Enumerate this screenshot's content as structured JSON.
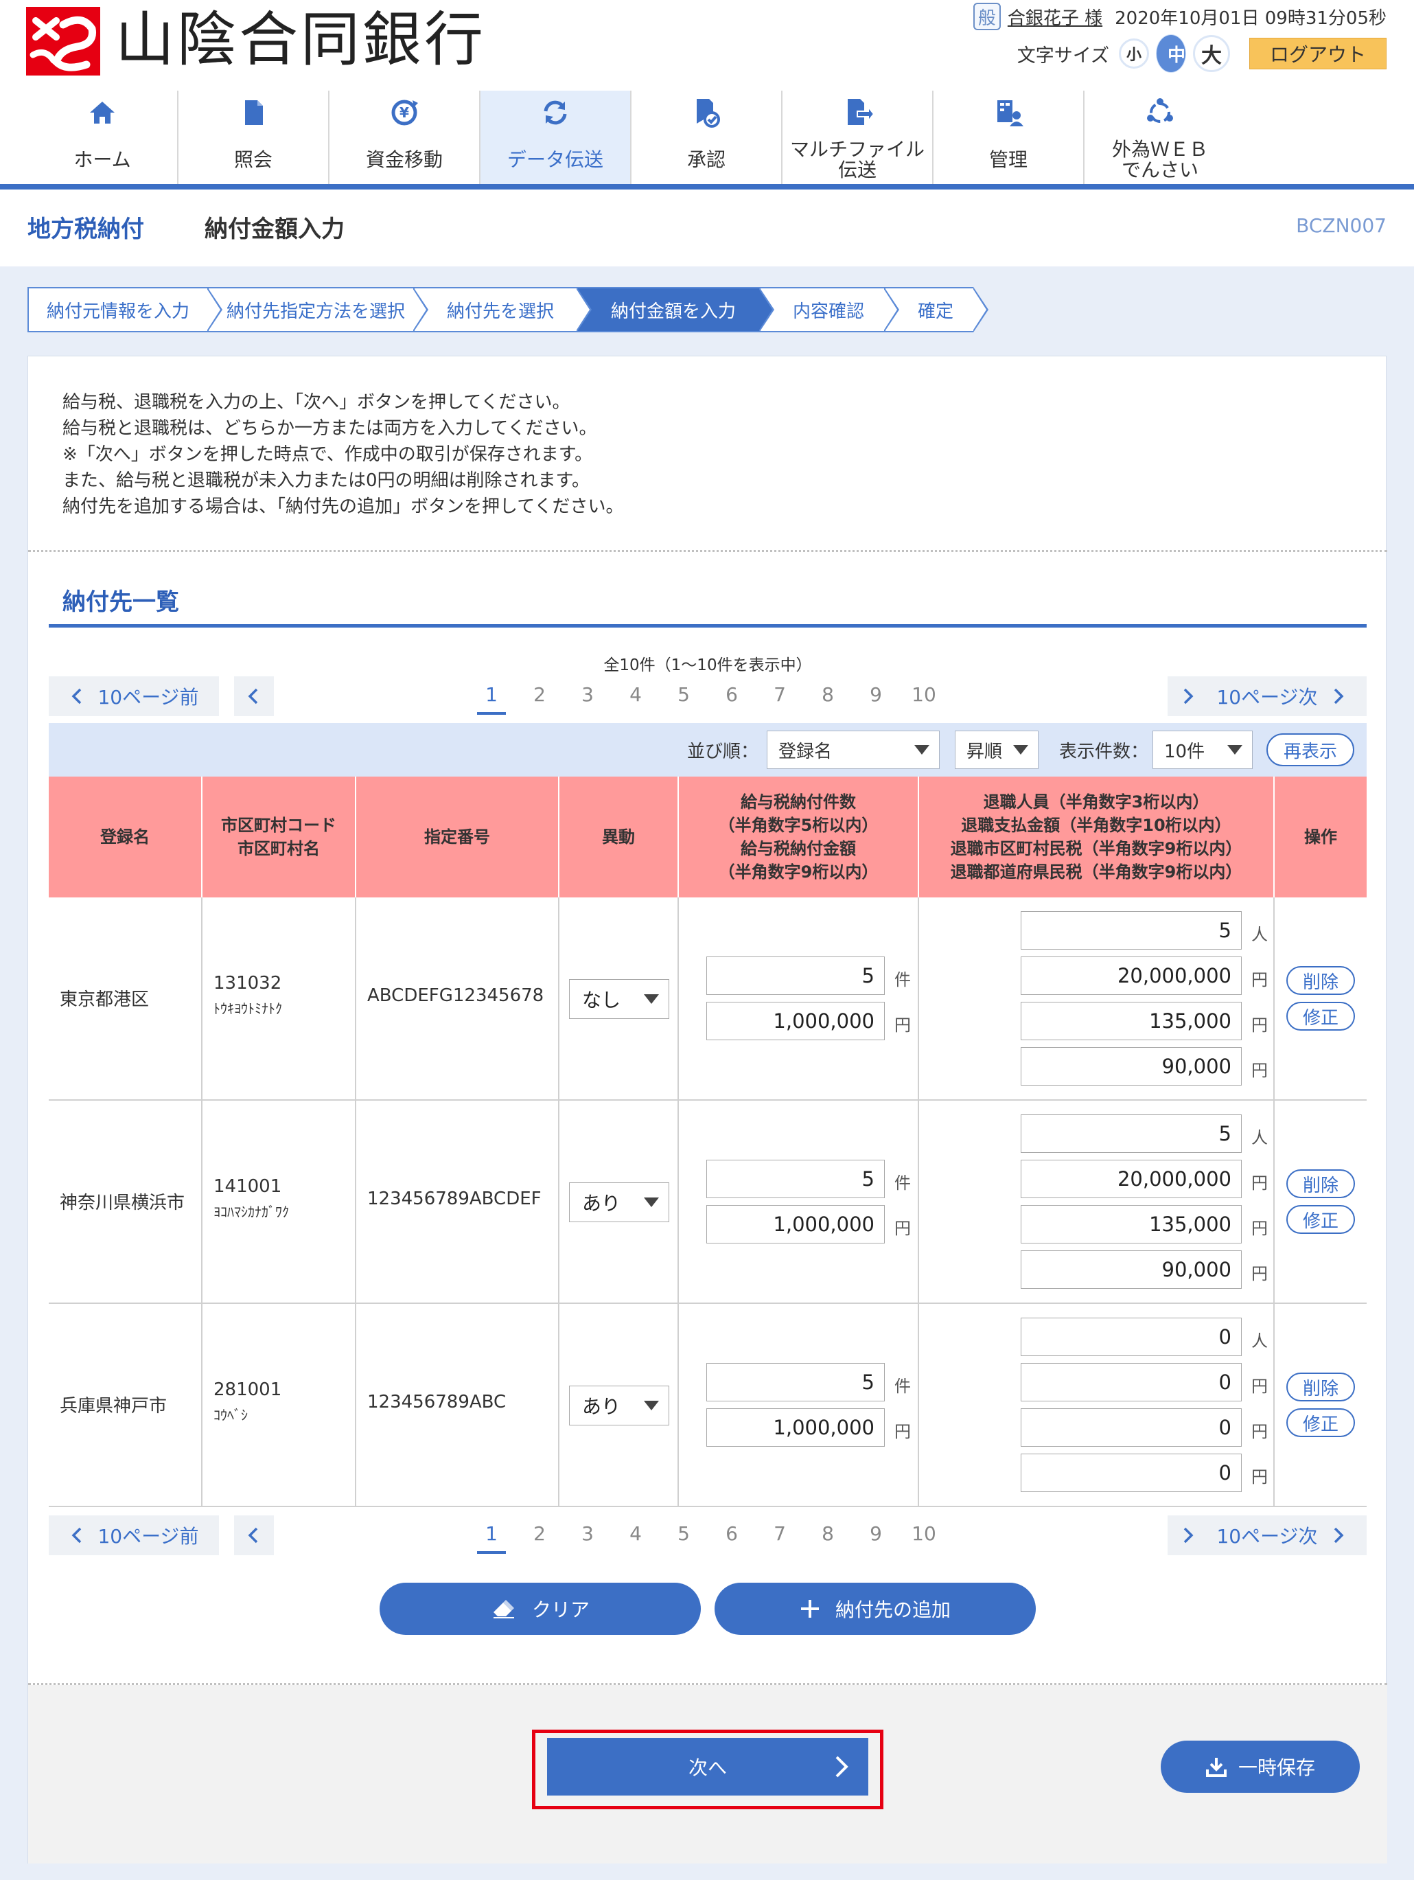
{
  "header": {
    "bank_name": "山陰合同銀行",
    "user_badge": "般",
    "user_name": "合銀花子 様",
    "datetime": "2020年10月01日 09時31分05秒",
    "font_size_label": "文字サイズ",
    "font_small": "小",
    "font_medium": "中",
    "font_large": "大",
    "logout": "ログアウト"
  },
  "nav": [
    {
      "label": "ホーム",
      "icon": "home-icon"
    },
    {
      "label": "照会",
      "icon": "document-icon"
    },
    {
      "label": "資金移動",
      "icon": "yen-transfer-icon"
    },
    {
      "label": "データ伝送",
      "icon": "refresh-icon",
      "active": true
    },
    {
      "label": "承認",
      "icon": "approval-icon"
    },
    {
      "label": "マルチファイル\n伝送",
      "icon": "file-transfer-icon"
    },
    {
      "label": "管理",
      "icon": "admin-icon"
    },
    {
      "label": "外為ＷＥＢ\nでんさい",
      "icon": "network-icon"
    }
  ],
  "title": {
    "category": "地方税納付",
    "page": "納付金額入力",
    "screen_code": "BCZN007"
  },
  "steps": [
    {
      "label": "納付元情報を入力"
    },
    {
      "label": "納付先指定方法を選択"
    },
    {
      "label": "納付先を選択"
    },
    {
      "label": "納付金額を入力",
      "active": true
    },
    {
      "label": "内容確認"
    },
    {
      "label": "確定"
    }
  ],
  "instructions": [
    "給与税、退職税を入力の上、「次へ」ボタンを押してください。",
    "給与税と退職税は、どちらか一方または両方を入力してください。",
    "※「次へ」ボタンを押した時点で、作成中の取引が保存されます。",
    "また、給与税と退職税が未入力または0円の明細は削除されます。",
    "納付先を追加する場合は、「納付先の追加」ボタンを押してください。"
  ],
  "list": {
    "title": "納付先一覧",
    "count_text": "全10件（1〜10件を表示中）",
    "pager": {
      "prev10": "10ページ前",
      "next10": "10ページ次",
      "pages": [
        "1",
        "2",
        "3",
        "4",
        "5",
        "6",
        "7",
        "8",
        "9",
        "10"
      ],
      "current": "1"
    },
    "sort": {
      "sort_label": "並び順：",
      "sort_value": "登録名",
      "order_value": "昇順",
      "count_label": "表示件数：",
      "count_value": "10件",
      "redisplay": "再表示"
    },
    "headers": {
      "name": "登録名",
      "code": "市区町村コード\n市区町村名",
      "number": "指定番号",
      "change": "異動",
      "salary": "給与税納付件数\n（半角数字5桁以内）\n給与税納付金額\n（半角数字9桁以内）",
      "retire": "退職人員（半角数字3桁以内）\n退職支払金額（半角数字10桁以内）\n退職市区町村民税（半角数字9桁以内）\n退職都道府県民税（半角数字9桁以内）",
      "ops": "操作"
    },
    "units": {
      "count": "件",
      "yen": "円",
      "person": "人"
    },
    "rows": [
      {
        "name": "東京都港区",
        "code": "131032",
        "kana": "ﾄｳｷﾖｳﾄﾐﾅﾄｸ",
        "number": "ABCDEFG12345678",
        "change": "なし",
        "salary_count": "5",
        "salary_amount": "1,000,000",
        "retire_people": "5",
        "retire_payment": "20,000,000",
        "retire_city_tax": "135,000",
        "retire_pref_tax": "90,000"
      },
      {
        "name": "神奈川県横浜市",
        "code": "141001",
        "kana": "ﾖｺﾊﾏｼｶﾅｶﾞﾜｸ",
        "number": "123456789ABCDEF",
        "change": "あり",
        "salary_count": "5",
        "salary_amount": "1,000,000",
        "retire_people": "5",
        "retire_payment": "20,000,000",
        "retire_city_tax": "135,000",
        "retire_pref_tax": "90,000"
      },
      {
        "name": "兵庫県神戸市",
        "code": "281001",
        "kana": "ｺｳﾍﾞｼ",
        "number": "123456789ABC",
        "change": "あり",
        "salary_count": "5",
        "salary_amount": "1,000,000",
        "retire_people": "0",
        "retire_payment": "0",
        "retire_city_tax": "0",
        "retire_pref_tax": "0"
      }
    ],
    "delete_label": "削除",
    "edit_label": "修正"
  },
  "actions": {
    "clear": "クリア",
    "add": "納付先の追加",
    "next": "次へ",
    "temp_save": "一時保存"
  },
  "colors": {
    "accent": "#3c6fc5",
    "header_row": "#ff9a9a",
    "logout": "#f8c35a",
    "highlight": "#e60012"
  }
}
